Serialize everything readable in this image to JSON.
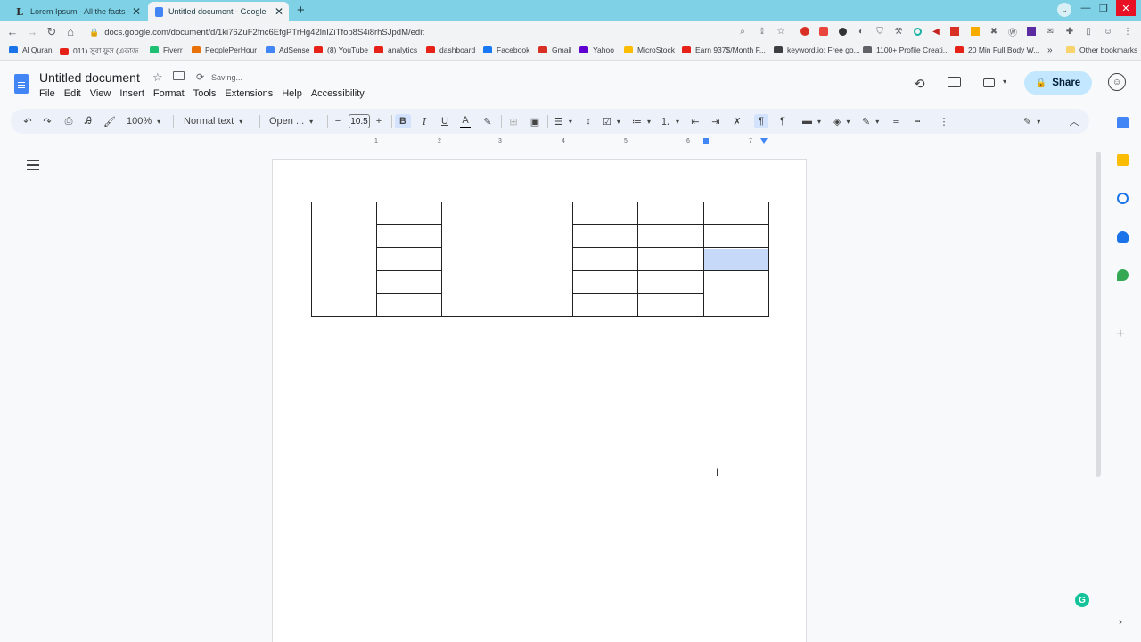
{
  "browser": {
    "tabs": [
      {
        "title": "Lorem Ipsum - All the facts - Lip",
        "favicon": "L"
      },
      {
        "title": "Untitled document - Google Doc",
        "favicon": "docs-icon",
        "active": true
      }
    ],
    "url": "docs.google.com/document/d/1ki76ZuF2fnc6EfgPTrHg42lnIZiTfop8S4i8rhSJpdM/edit",
    "bookmarks": [
      {
        "label": "Al Quran",
        "color": "#1a73e8"
      },
      {
        "label": "011) সুরা ফুস (একাজ...",
        "color": "#e62117"
      },
      {
        "label": "Fiverr",
        "color": "#1dbf73"
      },
      {
        "label": "PeoplePerHour",
        "color": "#e8710a"
      },
      {
        "label": "AdSense",
        "color": "#4285f4"
      },
      {
        "label": "(8) YouTube",
        "color": "#e62117"
      },
      {
        "label": "analytics",
        "color": "#e62117"
      },
      {
        "label": "dashboard",
        "color": "#e62117"
      },
      {
        "label": "Facebook",
        "color": "#1877f2"
      },
      {
        "label": "Gmail",
        "color": "#d93025"
      },
      {
        "label": "Yahoo",
        "color": "#6001d2"
      },
      {
        "label": "MicroStock",
        "color": "#fbbc04"
      },
      {
        "label": "Earn 937$/Month F...",
        "color": "#e62117"
      },
      {
        "label": "keyword.io: Free go...",
        "color": "#3c4043"
      },
      {
        "label": "1100+ Profile Creati...",
        "color": "#5f6368"
      },
      {
        "label": "20 Min Full Body W...",
        "color": "#e62117"
      }
    ],
    "more_bookmarks": "»",
    "other_bookmarks": "Other bookmarks"
  },
  "docs": {
    "title": "Untitled document",
    "save_status": "Saving...",
    "menu": [
      "File",
      "Edit",
      "View",
      "Insert",
      "Format",
      "Tools",
      "Extensions",
      "Help",
      "Accessibility"
    ],
    "share_label": "Share",
    "toolbar": {
      "zoom": "100%",
      "style": "Normal text",
      "font": "Open ...",
      "font_size": "10.5",
      "bold": "B",
      "italic": "I",
      "underline": "U",
      "text_color": "A"
    },
    "ruler_ticks": [
      "1",
      "2",
      "3",
      "4",
      "5",
      "6",
      "7"
    ]
  },
  "colors": {
    "tabstrip": "#7fd2e6",
    "toolbar_bg": "#edf2fa",
    "share_bg": "#c2e7ff",
    "selection": "#c7d9f9",
    "docs_blue": "#4285f4"
  }
}
